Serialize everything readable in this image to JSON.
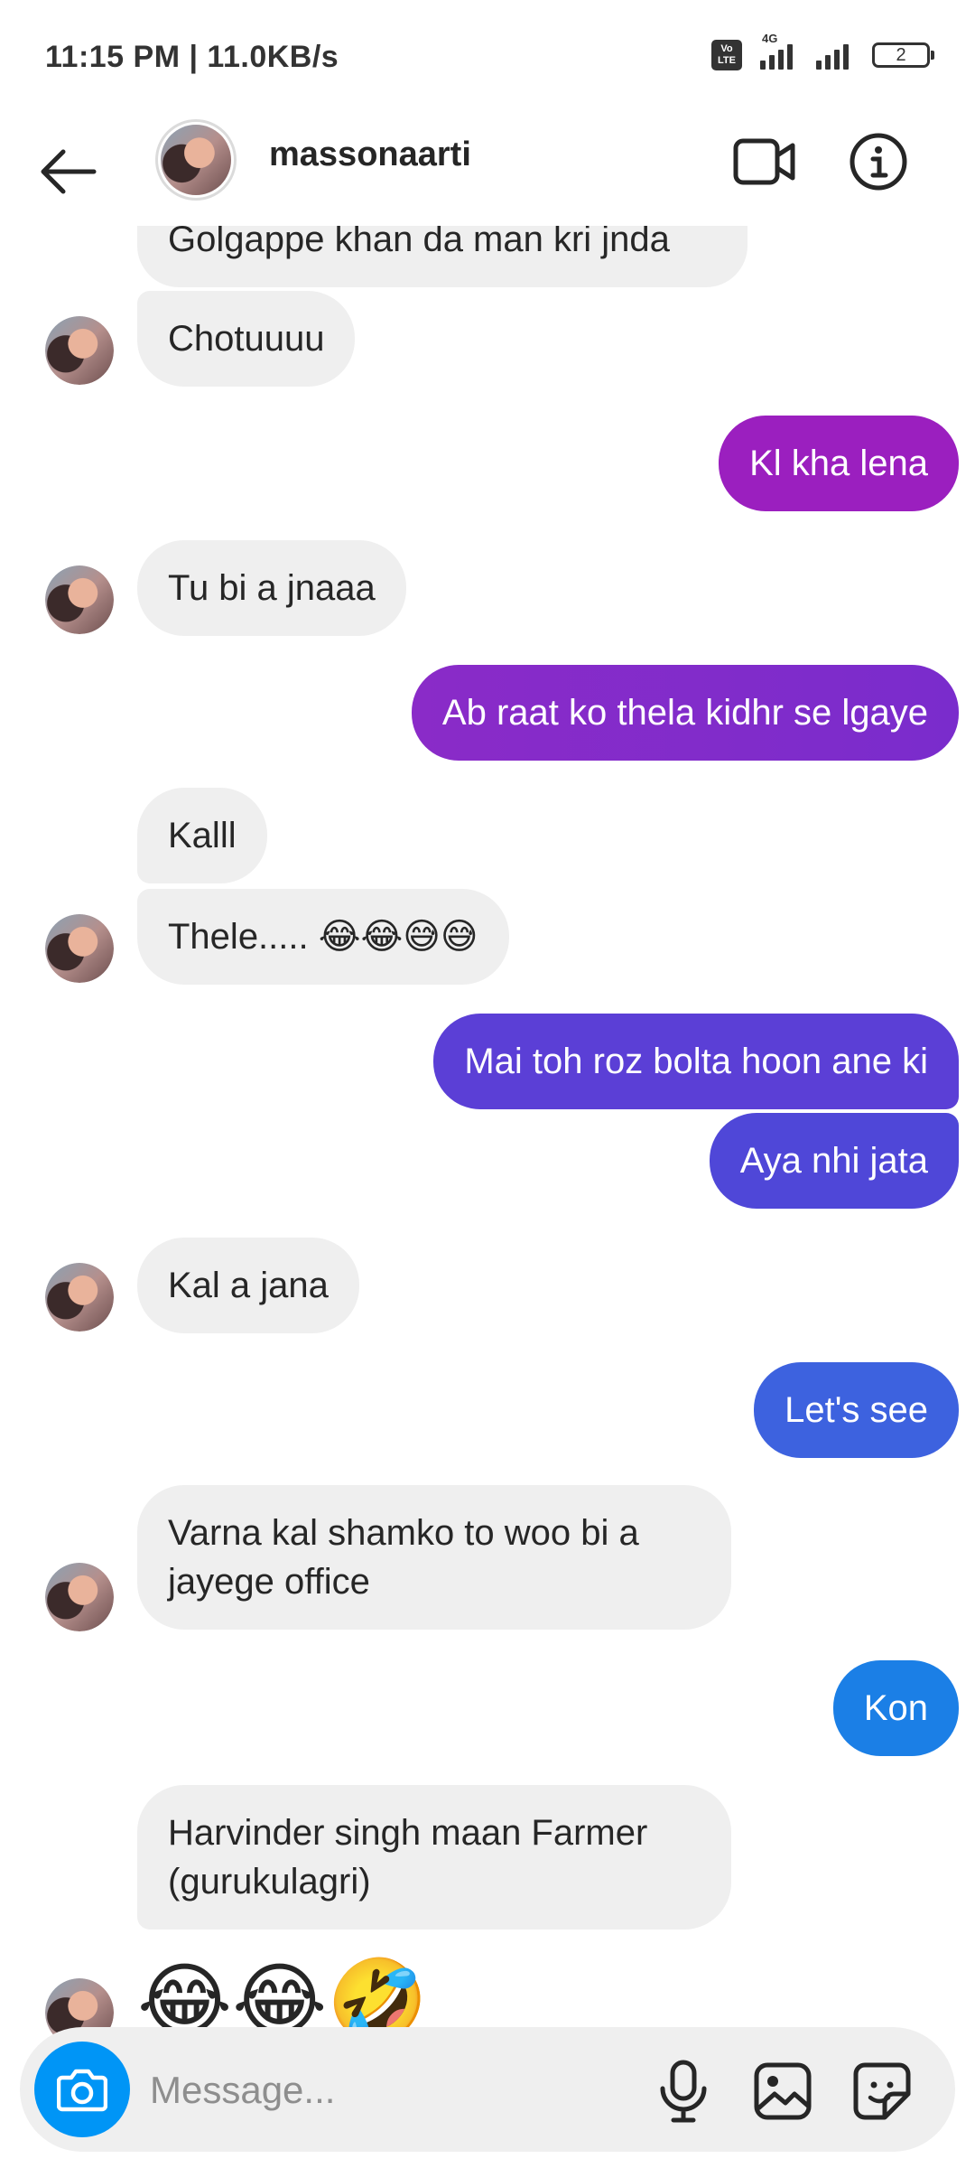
{
  "status_bar": {
    "time": "11:15 PM | 11.0KB/s",
    "volte": "Vo\nLTE",
    "network": "4G",
    "battery": "2"
  },
  "header": {
    "username": "massonaarti",
    "back_icon": "arrow-left-icon",
    "video_icon": "video-camera-icon",
    "info_icon": "info-icon"
  },
  "messages": [
    {
      "from": "them",
      "text": "Golgappe khan da man kri jnda"
    },
    {
      "from": "them",
      "text": "Chotuuuu"
    },
    {
      "from": "me",
      "text": "Kl kha lena"
    },
    {
      "from": "them",
      "text": "Tu bi a jnaaa"
    },
    {
      "from": "me",
      "text": "Ab raat ko thela kidhr se lgaye"
    },
    {
      "from": "them",
      "text": "Kalll"
    },
    {
      "from": "them",
      "text": "Thele..... 😂😂😅😅"
    },
    {
      "from": "me",
      "text": "Mai toh roz bolta hoon ane ki"
    },
    {
      "from": "me",
      "text": "Aya nhi jata"
    },
    {
      "from": "them",
      "text": "Kal a jana"
    },
    {
      "from": "me",
      "text": "Let's see"
    },
    {
      "from": "them",
      "text": "Varna kal shamko to woo bi a jayege office"
    },
    {
      "from": "me",
      "text": "Kon"
    },
    {
      "from": "them",
      "text": "Harvinder singh maan Farmer (gurukulagri)"
    },
    {
      "from": "them",
      "text": "😂😂🤣"
    }
  ],
  "composer": {
    "placeholder": "Message...",
    "camera_icon": "camera-icon",
    "mic_icon": "microphone-icon",
    "gallery_icon": "gallery-icon",
    "sticker_icon": "sticker-icon"
  },
  "colors": {
    "received_bubble": "#efefef",
    "sent_gradient": [
      "#9b1fbf",
      "#6c35d4",
      "#4a52d8",
      "#2f7ae8",
      "#1b7fe6"
    ],
    "camera_button": "#0095f6"
  }
}
